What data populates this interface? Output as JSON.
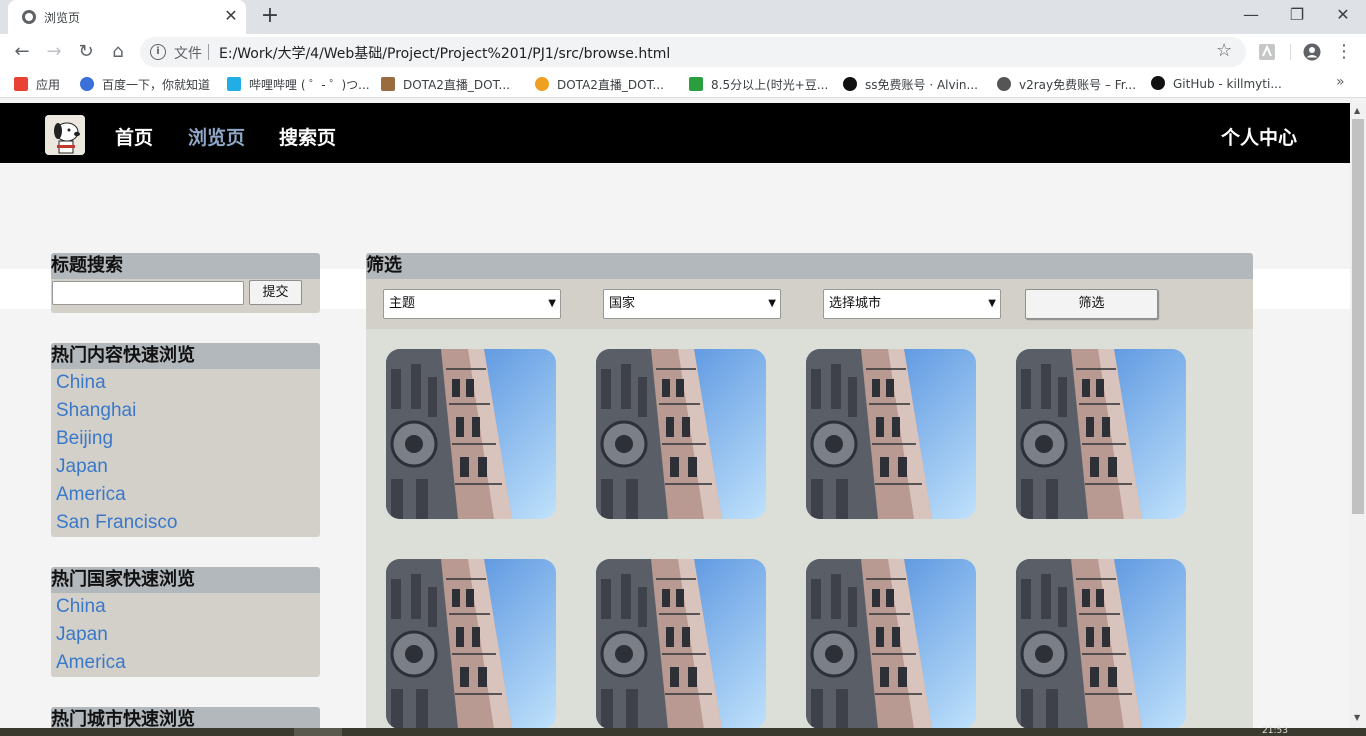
{
  "browser": {
    "tab_title": "浏览页",
    "new_tab": "+",
    "close_tab": "✕",
    "win_minimize": "—",
    "win_restore": "❐",
    "win_close": "✕",
    "omnibox_label": "文件",
    "url": "E:/Work/大学/4/Web基础/Project/Project%201/PJ1/src/browse.html",
    "bookmarks": [
      {
        "label": "应用",
        "color": "#e94235"
      },
      {
        "label": "百度一下，你就知道",
        "color": "#3b6fd9"
      },
      {
        "label": "哔哩哔哩 ( ゜- ゜)つ...",
        "color": "#23ade5"
      },
      {
        "label": "DOTA2直播_DOT...",
        "color": "#9a6b3c"
      },
      {
        "label": "DOTA2直播_DOT...",
        "color": "#f0a020"
      },
      {
        "label": "8.5分以上(时光+豆...",
        "color": "#2a9d3c"
      },
      {
        "label": "ss免费账号 · Alvin...",
        "color": "#111111"
      },
      {
        "label": "v2ray免费账号 – Fr...",
        "color": "#555555"
      },
      {
        "label": "GitHub - killmyti...",
        "color": "#111111"
      }
    ],
    "bookmarks_more": "»"
  },
  "nav": {
    "home": "首页",
    "browse": "浏览页",
    "search": "搜索页",
    "user_center": "个人中心"
  },
  "sidebar": {
    "title_search": {
      "heading": "标题搜索",
      "input_value": "",
      "submit": "提交"
    },
    "hot_content": {
      "heading": "热门内容快速浏览",
      "items": [
        "China",
        "Shanghai",
        "Beijing",
        "Japan",
        "America",
        "San Francisco"
      ]
    },
    "hot_country": {
      "heading": "热门国家快速浏览",
      "items": [
        "China",
        "Japan",
        "America"
      ]
    },
    "hot_city": {
      "heading": "热门城市快速浏览"
    }
  },
  "filter": {
    "heading": "筛选",
    "theme_select": "主题",
    "country_select": "国家",
    "city_select": "选择城市",
    "button": "筛选"
  },
  "gallery": {
    "count": 8
  },
  "taskbar": {
    "time": "21:53"
  },
  "colors": {
    "link": "#3a78c9",
    "nav_active": "#8fa7c7",
    "panel_bg": "#d3d0c9",
    "panel_head": "#b3b8bc"
  }
}
